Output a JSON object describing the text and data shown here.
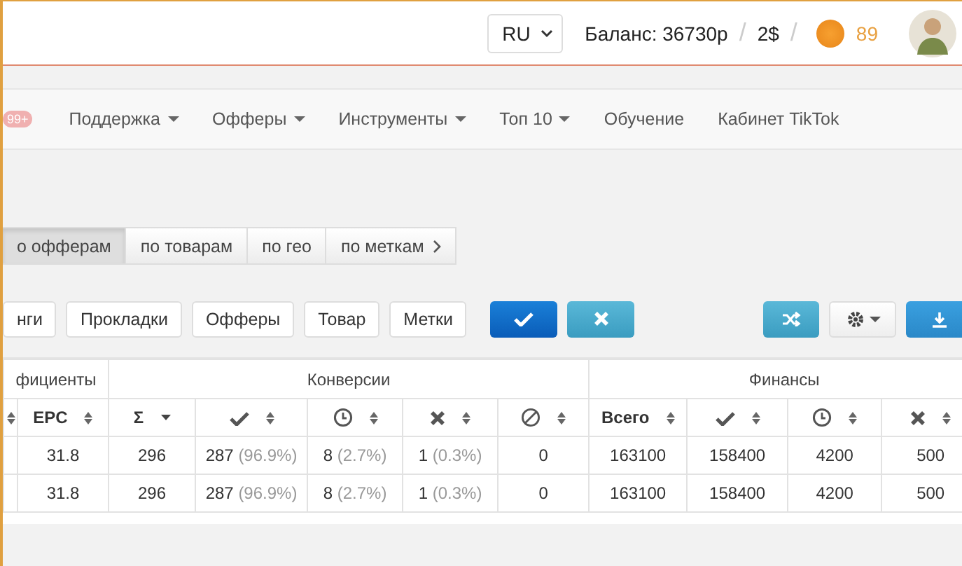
{
  "header": {
    "language": "RU",
    "balance": "Баланс: 36730р",
    "separators": [
      "/",
      "/"
    ],
    "dollars": "2$",
    "coins": "89"
  },
  "nav": {
    "badge": "99+",
    "items": [
      {
        "label": "Поддержка",
        "dropdown": true
      },
      {
        "label": "Офферы",
        "dropdown": true
      },
      {
        "label": "Инструменты",
        "dropdown": true
      },
      {
        "label": "Топ 10",
        "dropdown": true
      },
      {
        "label": "Обучение",
        "dropdown": false
      },
      {
        "label": "Кабинет TikTok",
        "dropdown": false
      }
    ]
  },
  "view_tabs": [
    {
      "label": "о офферам",
      "selected": true,
      "more": false
    },
    {
      "label": "по товарам",
      "selected": false,
      "more": false
    },
    {
      "label": "по гео",
      "selected": false,
      "more": false
    },
    {
      "label": "по меткам",
      "selected": false,
      "more": true
    }
  ],
  "filters": [
    "нги",
    "Прокладки",
    "Офферы",
    "Товар",
    "Метки"
  ],
  "actions": [
    {
      "kind": "apply"
    },
    {
      "kind": "reset"
    }
  ],
  "tools": [
    {
      "kind": "shuffle"
    },
    {
      "kind": "settings"
    },
    {
      "kind": "download"
    }
  ],
  "table": {
    "groups": [
      {
        "label": "фициенты",
        "columns": [
          {
            "kind": "blank",
            "sorted": false
          },
          {
            "kind": "text",
            "label": "EPC",
            "sorted": false
          }
        ]
      },
      {
        "label": "Конверсии",
        "columns": [
          {
            "kind": "text",
            "label": "Σ",
            "sorted": true
          },
          {
            "kind": "check",
            "sorted": false
          },
          {
            "kind": "clock",
            "sorted": false
          },
          {
            "kind": "cross",
            "sorted": false
          },
          {
            "kind": "ban",
            "sorted": false
          }
        ]
      },
      {
        "label": "Финансы",
        "columns": [
          {
            "kind": "text",
            "label": "Всего",
            "sorted": false
          },
          {
            "kind": "check",
            "sorted": false
          },
          {
            "kind": "clock",
            "sorted": false
          },
          {
            "kind": "cross",
            "sorted": false
          }
        ]
      }
    ],
    "rows": [
      [
        {},
        {
          "value": "31.8"
        },
        {
          "value": "296"
        },
        {
          "value": "287",
          "share": "(96.9%)"
        },
        {
          "value": "8",
          "share": "(2.7%)"
        },
        {
          "value": "1",
          "share": "(0.3%)"
        },
        {
          "value": "0"
        },
        {
          "value": "163100"
        },
        {
          "value": "158400"
        },
        {
          "value": "4200"
        },
        {
          "value": "500"
        }
      ],
      [
        {},
        {
          "value": "31.8"
        },
        {
          "value": "296"
        },
        {
          "value": "287",
          "share": "(96.9%)"
        },
        {
          "value": "8",
          "share": "(2.7%)"
        },
        {
          "value": "1",
          "share": "(0.3%)"
        },
        {
          "value": "0"
        },
        {
          "value": "163100"
        },
        {
          "value": "158400"
        },
        {
          "value": "4200"
        },
        {
          "value": "500"
        }
      ]
    ]
  }
}
